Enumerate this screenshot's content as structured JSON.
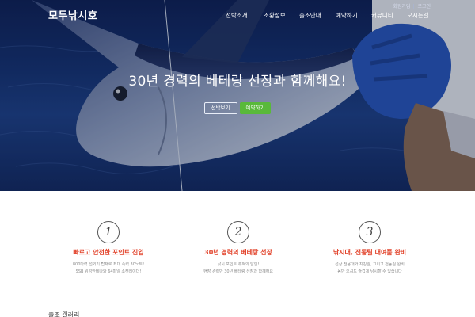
{
  "header": {
    "logo": "모두낚시호",
    "util_links": [
      "회원가입",
      "로그인"
    ],
    "nav": [
      "선박소개",
      "조황정보",
      "출조안내",
      "예약하기",
      "커뮤니티",
      "오시는길"
    ]
  },
  "hero": {
    "headline": "30년 경력의 베테랑 선장과 함께해요!",
    "buttons": {
      "intro": "선박보기",
      "reserve": "예약하기"
    }
  },
  "features": [
    {
      "number": "1",
      "title": "빠르고 안전한 포인트 진입",
      "desc": [
        "800마력 선외기 탑재로 최대 속력 30노트!",
        "SSB 위성안테나와 64마일 소켓레이더!"
      ]
    },
    {
      "number": "2",
      "title": "30년 경력의 베테랑 선장",
      "desc": [
        "낚시 포인트 추적의 달인!",
        "현장 경력만 30년 베테랑 선장과 함께해요"
      ]
    },
    {
      "number": "3",
      "title": "낚시대, 전동릴 대여품 완비",
      "desc": [
        "선상 전용대와 지깅릴, 그리고 전동릴 완비",
        "몸만 오셔도 즐겁게 낚시할 수 있습니다"
      ]
    }
  ],
  "gallery": {
    "title": "출조 갤러리"
  },
  "colors": {
    "accent_red": "#e2442c",
    "accent_green": "#59b93a",
    "hero_navy": "#14306e"
  }
}
